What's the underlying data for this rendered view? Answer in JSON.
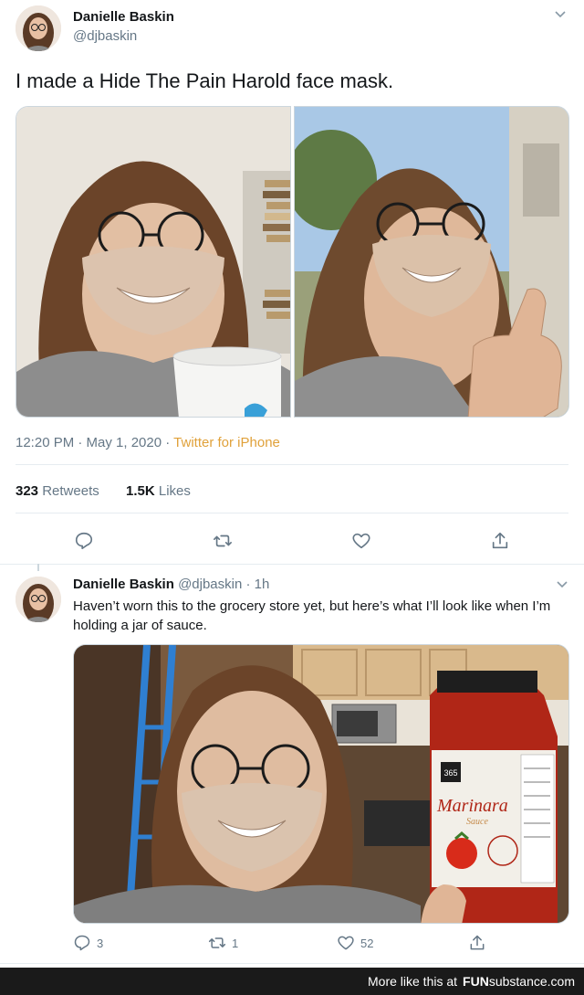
{
  "tweet": {
    "author_name": "Danielle Baskin",
    "author_handle": "@djbaskin",
    "text": "I made a Hide The Pain Harold face mask.",
    "timestamp": "12:20 PM · May 1, 2020 · ",
    "source": "Twitter for iPhone",
    "retweets_count": "323",
    "retweets_label": "Retweets",
    "likes_count": "1.5K",
    "likes_label": "Likes"
  },
  "reply": {
    "author_name": "Danielle Baskin",
    "author_handle": "@djbaskin",
    "time": "· 1h",
    "text": "Haven’t worn this to the grocery store yet, but here’s what I’ll look like when I’m holding a jar of sauce.",
    "reply_count": "3",
    "retweet_count": "1",
    "like_count": "52",
    "jar_brand": "365",
    "jar_label": "Marinara",
    "jar_sub": "Sauce"
  },
  "footer": {
    "text": "More like this at",
    "brand_main": "FUN",
    "brand_accent": "substance",
    "brand_tld": ".com"
  },
  "colors": {
    "accent": "#1da1f2",
    "source": "#e0a13a",
    "muted": "#657786"
  }
}
